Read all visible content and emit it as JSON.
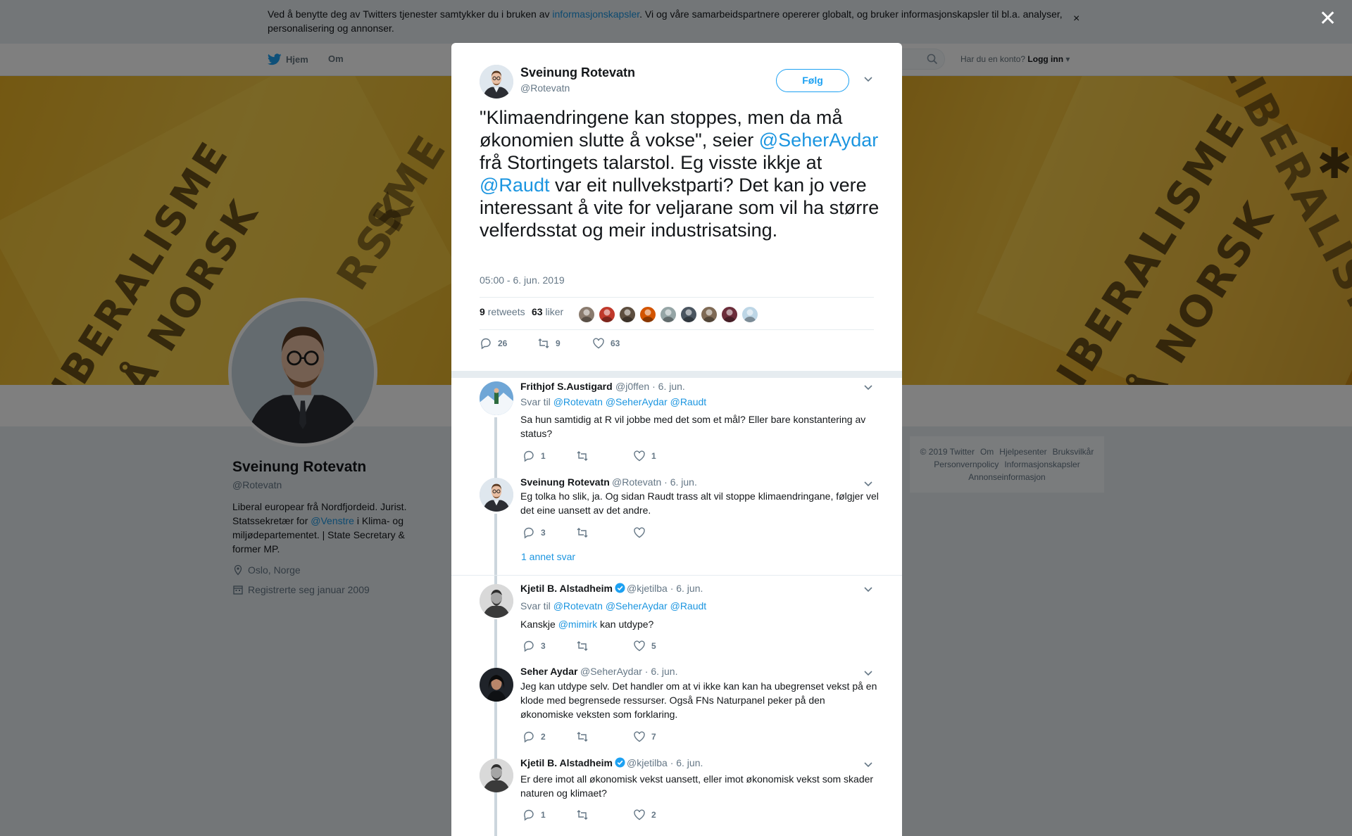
{
  "cookie_bar": {
    "text_before": "Ved å benytte deg av Twitters tjenester samtykker du i bruken av ",
    "link": "informasjonskapsler",
    "text_after": ". Vi og våre samarbeidspartnere opererer globalt, og bruker informasjonskapsler til bl.a. analyser, personalisering og annonser.",
    "close": "×"
  },
  "nav": {
    "home": "Hjem",
    "about": "Om",
    "login_prompt": "Har du en konto?",
    "login": "Logg inn"
  },
  "banner": {
    "words": [
      "LIBERALISME",
      "PÅ NORSK",
      "LIBERALISME",
      "PÅ NORSK",
      "LIBERALISME",
      "Å NORSK",
      "SME",
      "RSK"
    ]
  },
  "profile": {
    "name": "Sveinung Rotevatn",
    "handle": "@Rotevatn",
    "bio_1": "Liberal europear frå Nordfjordeid. Jurist. Statssekretær for ",
    "bio_link": "@Venstre",
    "bio_2": " i Klima- og miljødepartementet. | State Secretary & former MP.",
    "location": "Oslo, Norge",
    "joined": "Registrerte seg januar 2009"
  },
  "footer": {
    "links": [
      "© 2019 Twitter",
      "Om",
      "Hjelpesenter",
      "Bruksvilkår",
      "Personvernpolicy",
      "Informasjonskapsler",
      "Annonseinformasjon"
    ]
  },
  "overlay": {
    "close": "✕"
  },
  "tweet": {
    "author_name": "Sveinung Rotevatn",
    "author_handle": "@Rotevatn",
    "follow": "Følg",
    "text_1": "\"Klimaendringene kan stoppes, men da må økonomien slutte å vokse\", seier ",
    "mention_1": "@SeherAydar",
    "text_2": " frå Stortingets talarstol. Eg visste ikkje at ",
    "mention_2": "@Raudt",
    "text_3": " var eit nullvekstparti? Det kan jo vere interessant å vite for veljarane som vil ha større velferdsstat og meir industrisatsing.",
    "timestamp": "05:00 - 6. jun. 2019",
    "retweets_count": "9",
    "retweets_label": "retweets",
    "likes_count": "63",
    "likes_label": "liker",
    "reply_count": "26",
    "retweet_count": "9",
    "like_count": "63",
    "liker_avatar_colors": [
      "#8a7b6e",
      "#c0392b",
      "#5d4e3f",
      "#d35400",
      "#95a5a6",
      "#4a5560",
      "#7f6a55",
      "#6b2d3a",
      "#bdd6e6"
    ]
  },
  "replies": [
    {
      "name": "Frithjof S.Austigard",
      "handle": "@j0ffen",
      "date": "· 6. jun.",
      "reply_label": "Svar til",
      "reply_to": "@Rotevatn @SeherAydar @Raudt",
      "text": "Sa hun samtidig at R vil jobbe med det som et mål? Eller bare konstantering av status?",
      "replies": "1",
      "retweets": "",
      "likes": "1"
    },
    {
      "name": "Sveinung Rotevatn",
      "handle": "@Rotevatn",
      "date": "· 6. jun.",
      "text": "Eg tolka ho slik, ja. Og sidan Raudt trass alt vil stoppe klimaendringane, følgjer vel det eine uansett av det andre.",
      "replies": "3",
      "retweets": "",
      "likes": "",
      "more": "1 annet svar"
    },
    {
      "name": "Kjetil B. Alstadheim",
      "handle": "@kjetilba",
      "date": "· 6. jun.",
      "reply_label": "Svar til",
      "reply_to": "@Rotevatn @SeherAydar @Raudt",
      "text_before": "Kanskje ",
      "text_link": "@mimirk",
      "text_after": " kan utdype?",
      "replies": "3",
      "retweets": "",
      "likes": "5"
    },
    {
      "name": "Seher Aydar",
      "handle": "@SeherAydar",
      "date": "· 6. jun.",
      "text": "Jeg kan utdype selv. Det handler om at vi ikke kan kan ha ubegrenset vekst på en klode med begrensede ressurser. Også FNs Naturpanel peker på den økonomiske veksten som forklaring.",
      "replies": "2",
      "retweets": "",
      "likes": "7"
    },
    {
      "name": "Kjetil B. Alstadheim",
      "handle": "@kjetilba",
      "date": "· 6. jun.",
      "text": "Er dere imot all økonomisk vekst uansett, eller imot økonomisk vekst som skader naturen og klimaet?",
      "replies": "1",
      "retweets": "",
      "likes": "2"
    }
  ]
}
